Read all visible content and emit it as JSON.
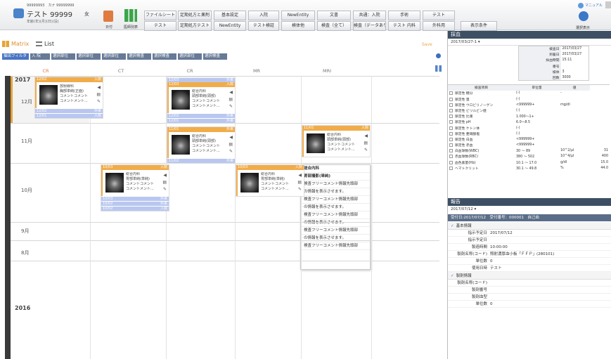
{
  "patient": {
    "ids": "99999993　カナ 99999999",
    "name": "テスト 99999",
    "sex": "女",
    "sub": "年齢(年)(月)(日)(没)"
  },
  "top_icons": {
    "day": "日付",
    "order": "医師別表",
    "manual": "マニュアル",
    "tool": "選択表示"
  },
  "tabs_row1": [
    "ファイルシート",
    "定期処方と薬剤",
    "基本設定",
    "入院",
    "NewEntity",
    "文書",
    "共通：入院",
    "手術",
    "テスト"
  ],
  "tabs_row2": [
    "テスト",
    "定期処方テスト",
    "NewEntity",
    "テスト検証",
    "検体他",
    "検査（全て）",
    "検査（データあり）",
    "テスト 内科",
    "外科用",
    "表示条件"
  ],
  "view": {
    "matrix": "Matrix",
    "list": "List",
    "save": "Save"
  },
  "filters": [
    "抽出フィルタ",
    "入 院",
    "選択部位",
    "選択部位",
    "選択部位",
    "選択検査",
    "選択検査",
    "選択部位",
    "選択検査"
  ],
  "columns": [
    "CR",
    "CT",
    "CR",
    "MR",
    "MRI"
  ],
  "years": {
    "y2017": "2017",
    "y2016": "2016"
  },
  "months": [
    "12月",
    "11月",
    "10月",
    "9月",
    "8月"
  ],
  "cards": {
    "c1": {
      "date": "12/02",
      "tag": "入院",
      "lines": [
        "放射線科",
        "胸部単純(正面)",
        "コメントコメント",
        "コメントメント..."
      ],
      "subs": [
        [
          "12/02",
          "外来"
        ],
        [
          "12/01",
          "入院"
        ]
      ]
    },
    "c2": {
      "date": "12/03",
      "tag": "入院",
      "pre": [
        "12/03",
        "外来"
      ],
      "lines": [
        "総合内科",
        "頭部単純(頭部)",
        "コメントコメント",
        "コメントメント..."
      ],
      "subs": [
        [
          "12/02",
          "外来"
        ],
        [
          "12/01",
          "外来"
        ]
      ]
    },
    "c3": {
      "date": "11/01",
      "tag": "外来",
      "lines": [
        "総合内科",
        "頭部単純(頭部)",
        "コメントコメント",
        "コメントメント..."
      ],
      "subs": [
        [
          "11/02",
          "外来"
        ]
      ]
    },
    "c4": {
      "date": "11/01",
      "tag": "入院",
      "lines": [
        "総合内科",
        "頭部単純(頭部)",
        "コメントコメント",
        "コメントメント..."
      ],
      "subs": []
    },
    "c5": {
      "date": "10/03",
      "tag": "入院",
      "lines": [
        "総合内科",
        "胃部単純(単純)",
        "コメントコメント",
        "コメントメント..."
      ],
      "subs": [
        [
          "10/03",
          "外来"
        ],
        [
          "10/02",
          "外来"
        ],
        [
          "10/02",
          "入院"
        ]
      ]
    },
    "c6": {
      "date": "10/03",
      "tag": "入院",
      "lines": [
        "総合内科",
        "胃部単純(単純)",
        "コメントコメント",
        "コメントメント..."
      ],
      "subs": []
    }
  },
  "popup": {
    "title": "総合内科",
    "sub": "胃部撮影(単純)",
    "lines": [
      "検査フリーコメント情報先頭部",
      "の情報を表示させます。",
      "検査フリーコメント情報先頭部",
      "の情報を表示させます。",
      "検査フリーコメント情報先頭部",
      "の情報を表示させます。",
      "検査フリーコメント情報先頭部",
      "の情報を表示させます。",
      "検査フリーコメント情報先頭部"
    ]
  },
  "right_top": {
    "title": "採血",
    "date": "2017/03/27-1 ▾",
    "info": [
      [
        "検査日",
        "2017/03/27"
      ],
      [
        "到着日",
        "2017/03/27"
      ],
      [
        "採血時間",
        "15:11"
      ],
      [
        "番号",
        ""
      ],
      [
        "検体",
        "3"
      ],
      [
        "回数",
        "3000"
      ]
    ],
    "head": [
      "検査項目",
      "単位量",
      "値"
    ],
    "rows": [
      [
        "尿定性 糖分",
        "(-)",
        "-"
      ],
      [
        "尿定性 量",
        "(-)",
        ""
      ],
      [
        "尿定性 ウロビリノーゲン",
        "<999999+",
        "mg/dl"
      ],
      [
        "尿定性 ビリルビン値",
        "(-)",
        ""
      ],
      [
        "尿定性 比重",
        "1.000～1+",
        ""
      ],
      [
        "尿定性 pH",
        "6.0～8.5",
        ""
      ],
      [
        "尿定性 ケトン体",
        "(-)",
        ""
      ],
      [
        "尿定性 亜硝酸塩",
        "(-)",
        ""
      ],
      [
        "尿定性 白血",
        "<999999+",
        ""
      ],
      [
        "尿定性 赤血",
        "<999999+",
        ""
      ],
      [
        "白血球数(WBC)",
        "30 ～ 89",
        "10^2/μl",
        "31"
      ],
      [
        "赤血球数(RBC)",
        "380 ～ 502",
        "10^4/μl",
        "400"
      ],
      [
        "血色素量(Hb)",
        "10.1 ～ 17.0",
        "g/dl",
        "15.0"
      ],
      [
        "ヘマトクリット",
        "30.1 ～ 49.8",
        "%",
        "44.0"
      ]
    ]
  },
  "right_bottom": {
    "title": "報告",
    "date": "2017/07/12 ▾",
    "header": "受付日:2017/07/12　受付番号：000001　自己血",
    "g1": "基本情報",
    "f1": [
      [
        "指示予定日",
        "2017/07/12"
      ],
      [
        "指示予定日",
        ""
      ],
      [
        "製造時間",
        "10:00:00"
      ],
      [
        "製剤名称(コード)",
        "照射濃厚血小板「ＦＦＰ」(280101)"
      ],
      [
        "単位数",
        "0"
      ],
      [
        "使用日時",
        "テスト"
      ]
    ],
    "g2": "製剤情報",
    "f2": [
      [
        "製剤名称(コード)",
        ""
      ],
      [
        "製剤番号",
        ""
      ],
      [
        "製剤血型",
        ""
      ],
      [
        "単位数",
        "0"
      ]
    ]
  }
}
